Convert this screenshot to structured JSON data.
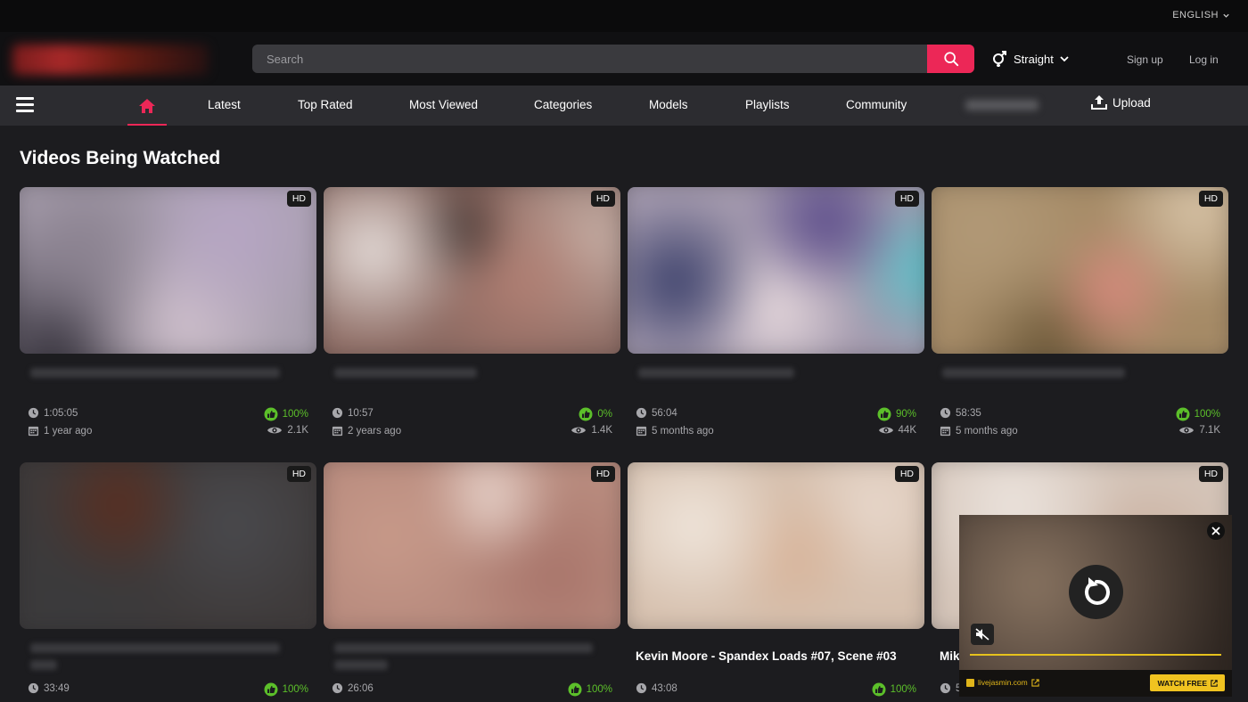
{
  "header": {
    "language": "ENGLISH",
    "search_placeholder": "Search",
    "orientation": "Straight",
    "signup": "Sign up",
    "login": "Log in"
  },
  "nav": {
    "items": [
      "Latest",
      "Top Rated",
      "Most Viewed",
      "Categories",
      "Models",
      "Playlists",
      "Community"
    ],
    "upload": "Upload"
  },
  "section_title": "Videos Being Watched",
  "videos": [
    {
      "hd": "HD",
      "title": "",
      "duration": "1:05:05",
      "date": "1 year ago",
      "rating": "100%",
      "views": "2.1K"
    },
    {
      "hd": "HD",
      "title": "",
      "duration": "10:57",
      "date": "2 years ago",
      "rating": "0%",
      "views": "1.4K"
    },
    {
      "hd": "HD",
      "title": "",
      "duration": "56:04",
      "date": "5 months ago",
      "rating": "90%",
      "views": "44K"
    },
    {
      "hd": "HD",
      "title": "",
      "duration": "58:35",
      "date": "5 months ago",
      "rating": "100%",
      "views": "7.1K"
    },
    {
      "hd": "HD",
      "title": "",
      "duration": "33:49",
      "date": "",
      "rating": "100%",
      "views": ""
    },
    {
      "hd": "HD",
      "title": "",
      "duration": "26:06",
      "date": "",
      "rating": "100%",
      "views": ""
    },
    {
      "hd": "HD",
      "title": "Kevin Moore - Spandex Loads #07, Scene #03",
      "duration": "43:08",
      "date": "",
      "rating": "100%",
      "views": ""
    },
    {
      "hd": "HD",
      "title": "Mik",
      "duration": "5",
      "date": "",
      "rating": "",
      "views": ""
    }
  ],
  "ad": {
    "brand": "livejasmin.com",
    "cta": "WATCH FREE"
  },
  "colors": {
    "accent": "#ec2757",
    "rating_green": "#5cbf2a",
    "ad_yellow": "#f0c320"
  }
}
